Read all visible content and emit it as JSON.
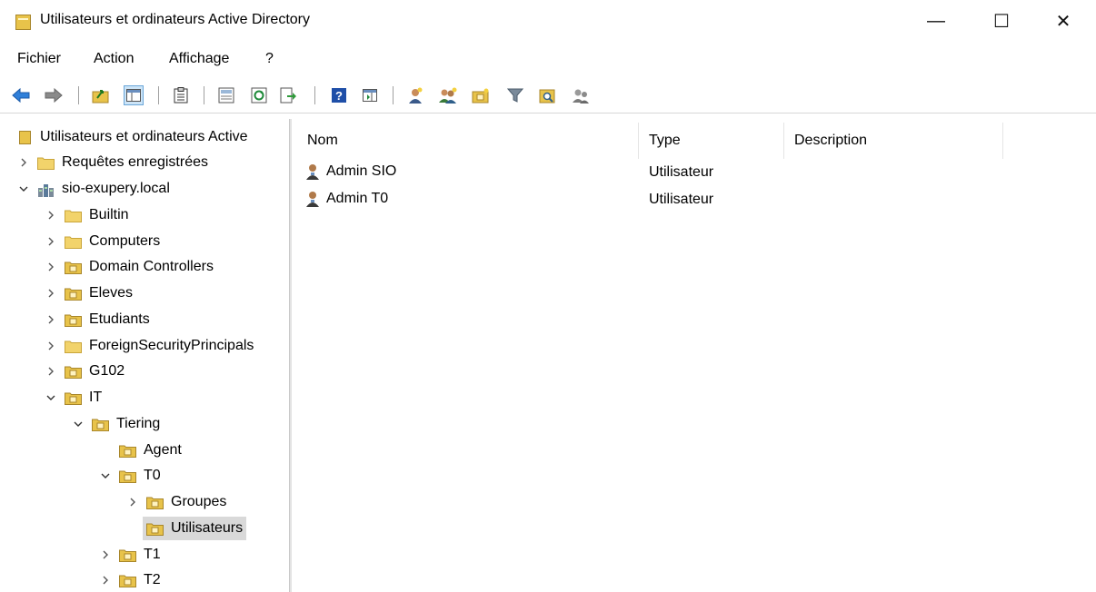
{
  "window": {
    "title": "Utilisateurs et ordinateurs Active Directory",
    "controls": {
      "minimize": "—",
      "maximize": "☐",
      "close": "✕"
    }
  },
  "menu": [
    "Fichier",
    "Action",
    "Affichage",
    "?"
  ],
  "toolbar": [
    "back-icon",
    "forward-icon",
    "up-folder-icon",
    "show-console-tree-icon",
    "clipboard-icon",
    "properties-icon",
    "refresh-icon",
    "export-list-icon",
    "help-icon",
    "show-action-pane-icon",
    "new-user-icon",
    "new-group-icon",
    "new-ou-icon",
    "filter-icon",
    "find-icon",
    "add-to-group-icon"
  ],
  "tree": {
    "root": "Utilisateurs et ordinateurs Active",
    "saved_queries": "Requêtes enregistrées",
    "domain": "sio-exupery.local",
    "builtin": "Builtin",
    "computers": "Computers",
    "domain_controllers": "Domain Controllers",
    "eleves": "Eleves",
    "etudiants": "Etudiants",
    "foreign": "ForeignSecurityPrincipals",
    "g102": "G102",
    "it": "IT",
    "tiering": "Tiering",
    "agent": "Agent",
    "t0": "T0",
    "groupes": "Groupes",
    "utilisateurs": "Utilisateurs",
    "t1": "T1",
    "t2": "T2"
  },
  "list": {
    "columns": {
      "name": "Nom",
      "type": "Type",
      "description": "Description"
    },
    "rows": [
      {
        "name": "Admin SIO",
        "type": "Utilisateur",
        "description": ""
      },
      {
        "name": "Admin T0",
        "type": "Utilisateur",
        "description": ""
      }
    ]
  },
  "colors": {
    "selection": "#d9d9d9",
    "folder": "#f2d36b",
    "ou_folder": "#e8c34a"
  }
}
